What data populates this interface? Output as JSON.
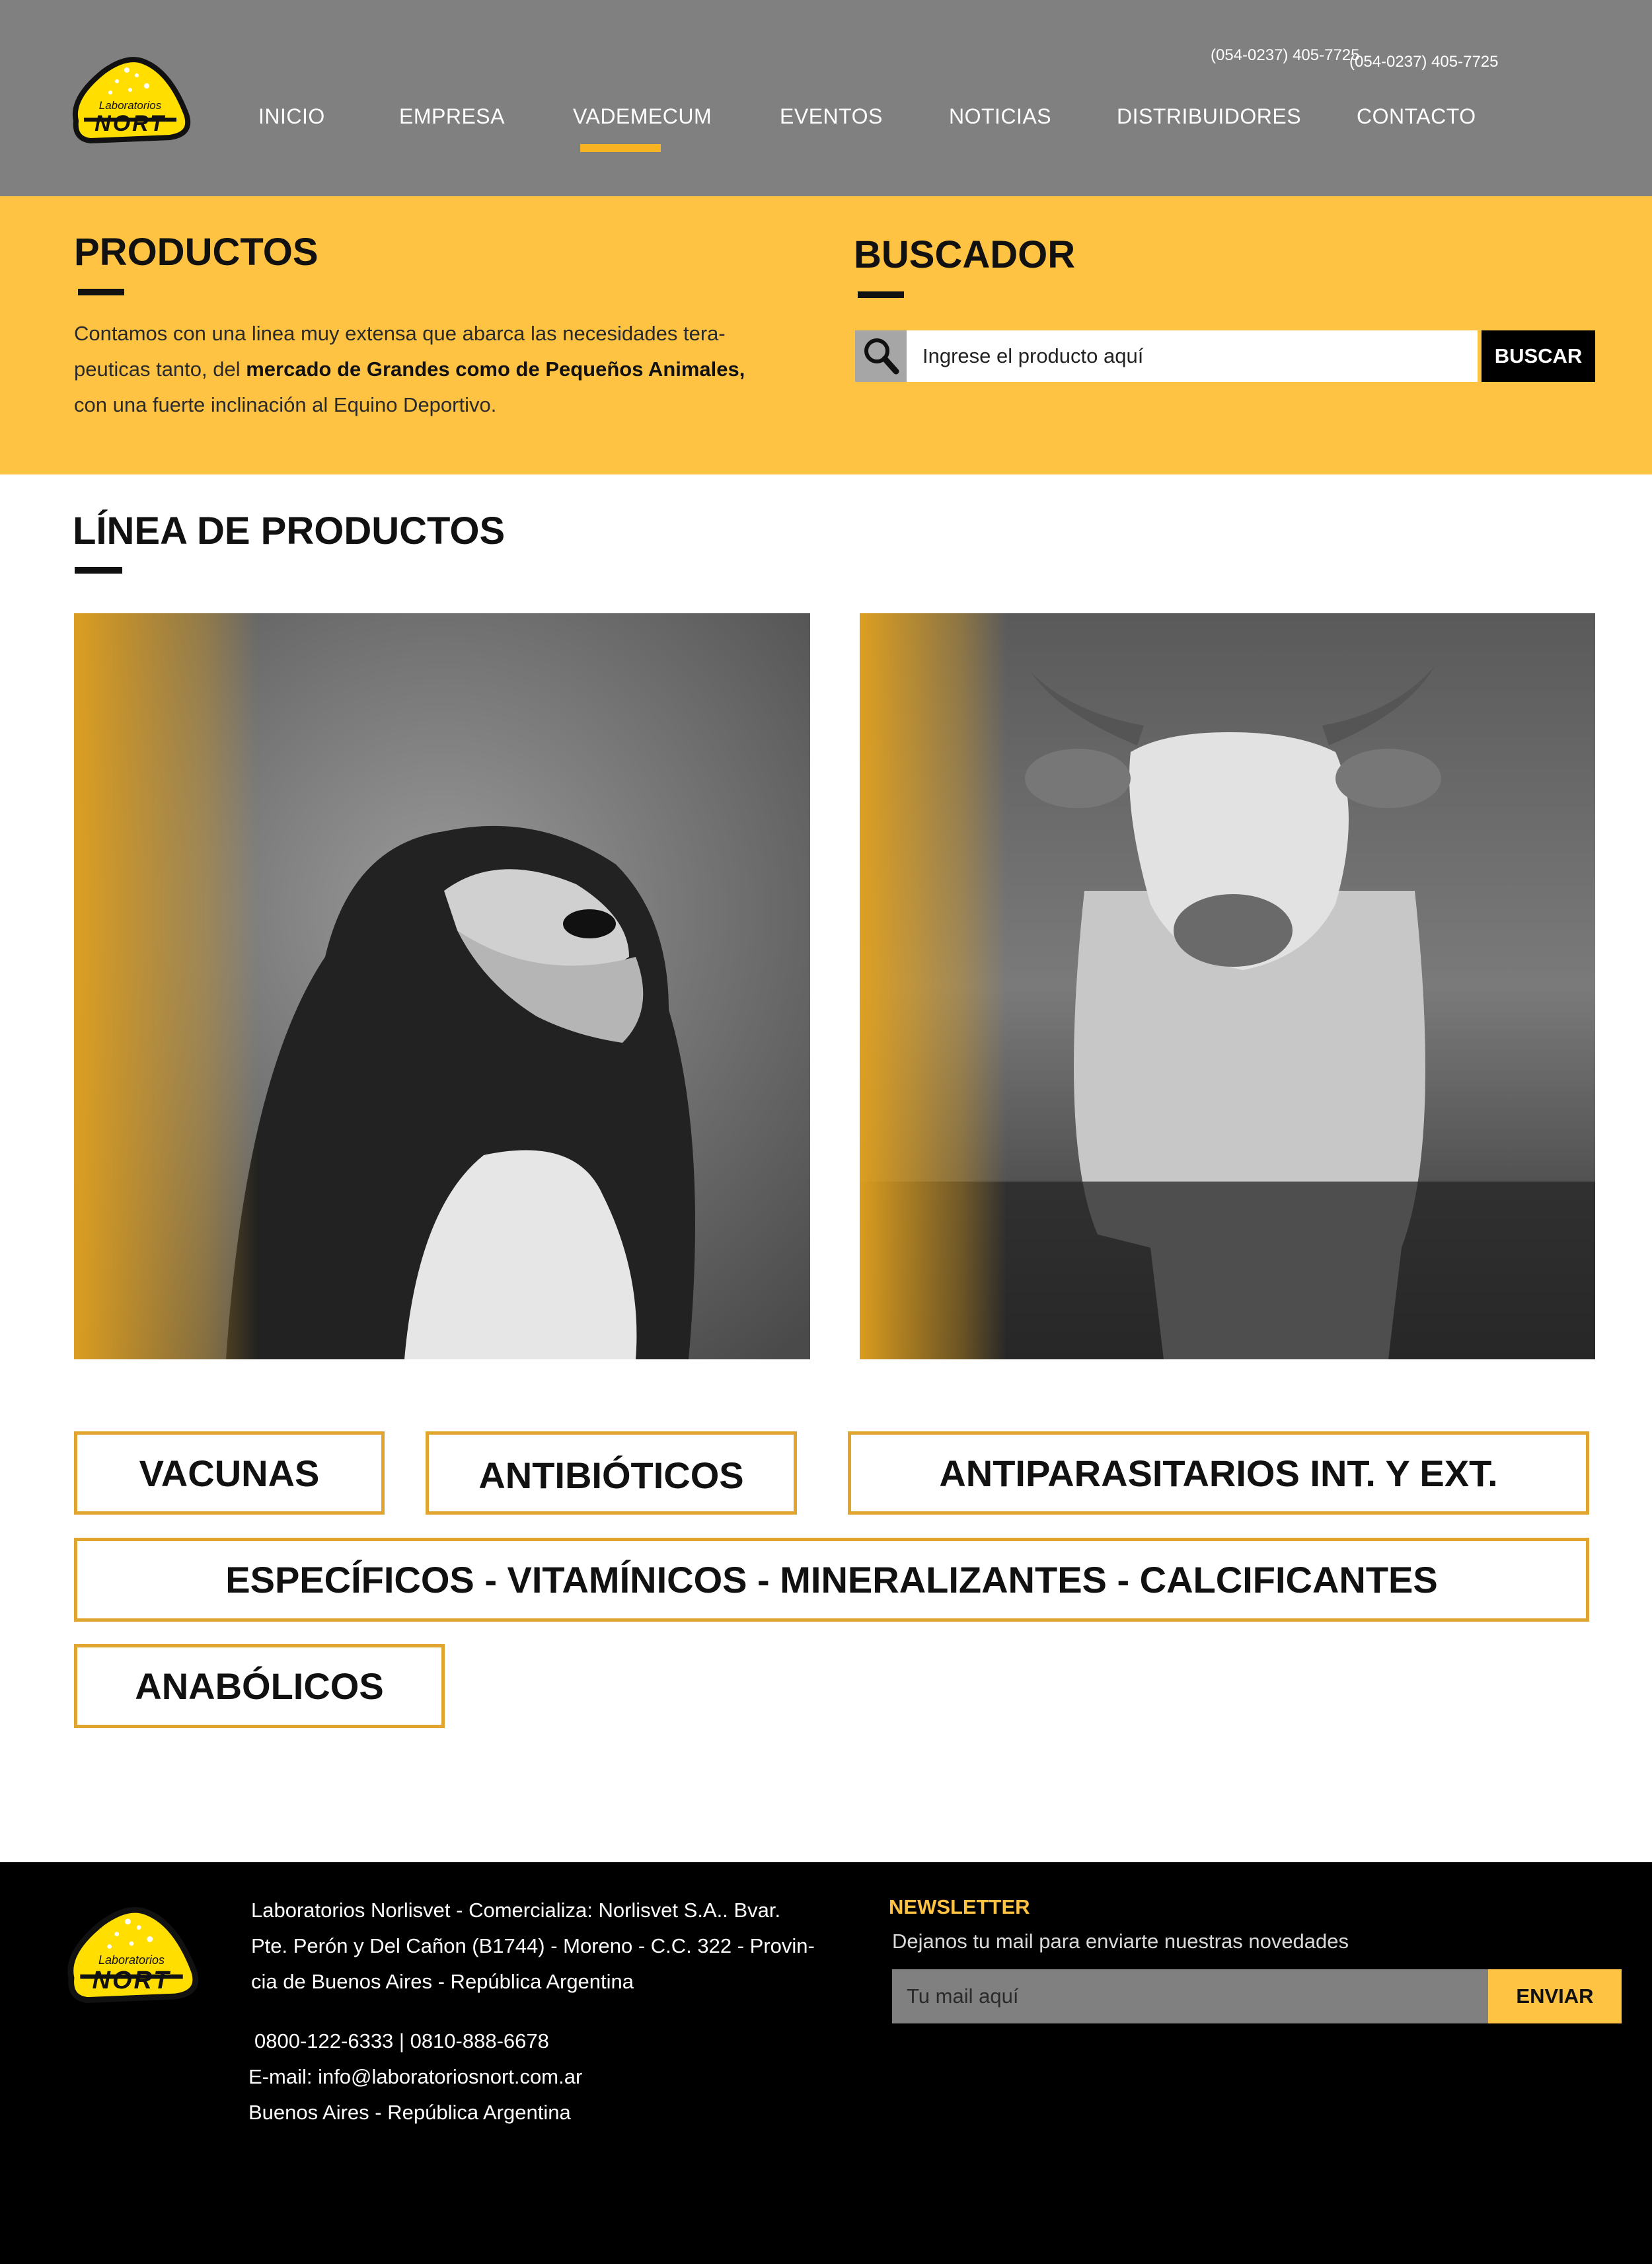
{
  "header": {
    "logo": {
      "top_text": "Laboratorios",
      "brand": "NORT"
    },
    "phone_1": "(054-0237) 405-7725",
    "phone_2": "(054-0237) 405-7725",
    "nav": [
      {
        "label": "INICIO"
      },
      {
        "label": "EMPRESA"
      },
      {
        "label": "VADEMECUM",
        "active": true
      },
      {
        "label": "EVENTOS"
      },
      {
        "label": "NOTICIAS"
      },
      {
        "label": "DISTRIBUIDORES"
      },
      {
        "label": "CONTACTO"
      }
    ]
  },
  "productos": {
    "title": "PRODUCTOS",
    "text_1": "Contamos con una linea muy  extensa que abarca las necesidades tera-",
    "text_2a": "peuticas tanto, del ",
    "text_2b": "mercado de Grandes como de Pequeños Animales,",
    "text_3": "con una fuerte inclinación al Equino Deportivo."
  },
  "buscador": {
    "title": "BUSCADOR",
    "placeholder": "Ingrese el producto aquí",
    "button": "BUSCAR"
  },
  "linea": {
    "title": "LÍNEA DE PRODUCTOS",
    "images": [
      {
        "subject": "dog"
      },
      {
        "subject": "cow"
      }
    ],
    "categories": [
      "VACUNAS",
      "ANTIBIÓTICOS",
      "ANTIPARASITARIOS INT. Y EXT.",
      "ESPECÍFICOS - VITAMÍNICOS - MINERALIZANTES - CALCIFICANTES",
      "ANABÓLICOS"
    ]
  },
  "footer": {
    "address_1": "Laboratorios Norlisvet - Comercializa: Norlisvet S.A.. Bvar.",
    "address_2": "Pte. Perón y Del Cañon (B1744) - Moreno - C.C. 322 - Provin-",
    "address_3": "cia de Buenos Aires - República Argentina",
    "phones": "0800-122-6333 | 0810-888-6678",
    "email": "E-mail: info@laboratoriosnort.com.ar",
    "location": "Buenos Aires - República Argentina",
    "newsletter": {
      "title": "NEWSLETTER",
      "subtitle": "Dejanos tu mail para enviarte nuestras novedades",
      "placeholder": "Tu mail aquí",
      "button": "ENVIAR"
    }
  },
  "colors": {
    "header_bg": "#808080",
    "accent_yellow": "#ffc343",
    "border_gold": "#e0a52e",
    "footer_bg": "#000000"
  }
}
